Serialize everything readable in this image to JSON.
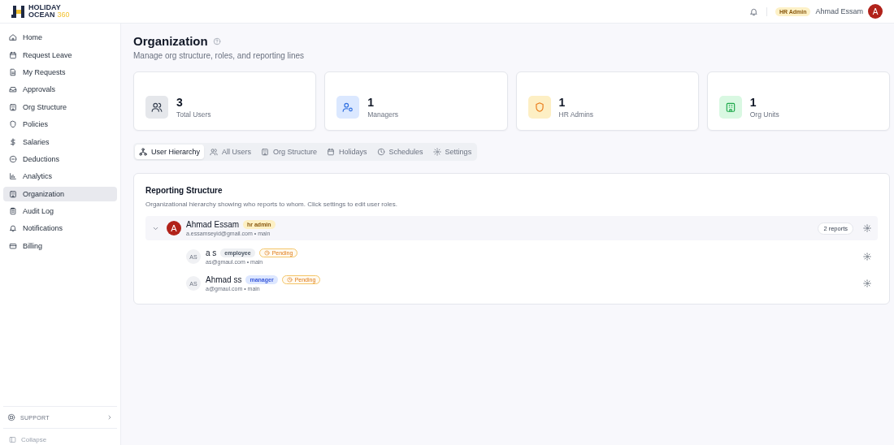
{
  "brand": {
    "name_line1": "HOLIDAY",
    "name_line2": "OCEAN",
    "name_suffix": "360"
  },
  "topbar": {
    "role_badge": "HR Admin",
    "user_name": "Ahmad Essam",
    "avatar_initial": "A"
  },
  "sidebar": {
    "items": [
      {
        "label": "Home",
        "selected": false
      },
      {
        "label": "Request Leave",
        "selected": false
      },
      {
        "label": "My Requests",
        "selected": false
      },
      {
        "label": "Approvals",
        "selected": false
      },
      {
        "label": "Org Structure",
        "selected": false
      },
      {
        "label": "Policies",
        "selected": false
      },
      {
        "label": "Salaries",
        "selected": false
      },
      {
        "label": "Deductions",
        "selected": false
      },
      {
        "label": "Analytics",
        "selected": false
      },
      {
        "label": "Organization",
        "selected": true
      },
      {
        "label": "Audit Log",
        "selected": false
      },
      {
        "label": "Notifications",
        "selected": false
      },
      {
        "label": "Billing",
        "selected": false
      }
    ],
    "support": "SUPPORT",
    "collapse": "Collapse"
  },
  "page": {
    "title": "Organization",
    "subtitle": "Manage org structure, roles, and reporting lines"
  },
  "stats": [
    {
      "value": "3",
      "label": "Total Users"
    },
    {
      "value": "1",
      "label": "Managers"
    },
    {
      "value": "1",
      "label": "HR Admins"
    },
    {
      "value": "1",
      "label": "Org Units"
    }
  ],
  "tabs": [
    {
      "label": "User Hierarchy",
      "selected": true
    },
    {
      "label": "All Users",
      "selected": false
    },
    {
      "label": "Org Structure",
      "selected": false
    },
    {
      "label": "Holidays",
      "selected": false
    },
    {
      "label": "Schedules",
      "selected": false
    },
    {
      "label": "Settings",
      "selected": false
    }
  ],
  "panel": {
    "title": "Reporting Structure",
    "description": "Organizational hierarchy showing who reports to whom. Click settings to edit user roles.",
    "tree": [
      {
        "name": "Ahmad Essam",
        "avatar": "A",
        "role": {
          "label": "hr admin",
          "kind": "admin"
        },
        "meta": "a.essamseyid@gmail.com • main",
        "reports": "2 reports",
        "expanded": true,
        "children": [
          {
            "name": "a s",
            "avatar": "AS",
            "role": {
              "label": "employee",
              "kind": "employee"
            },
            "status": "Pending",
            "meta": "as@gmaul.com • main"
          },
          {
            "name": "Ahmad ss",
            "avatar": "AS",
            "role": {
              "label": "manager",
              "kind": "manager"
            },
            "status": "Pending",
            "meta": "a@gmaul.com • main"
          }
        ]
      }
    ]
  }
}
